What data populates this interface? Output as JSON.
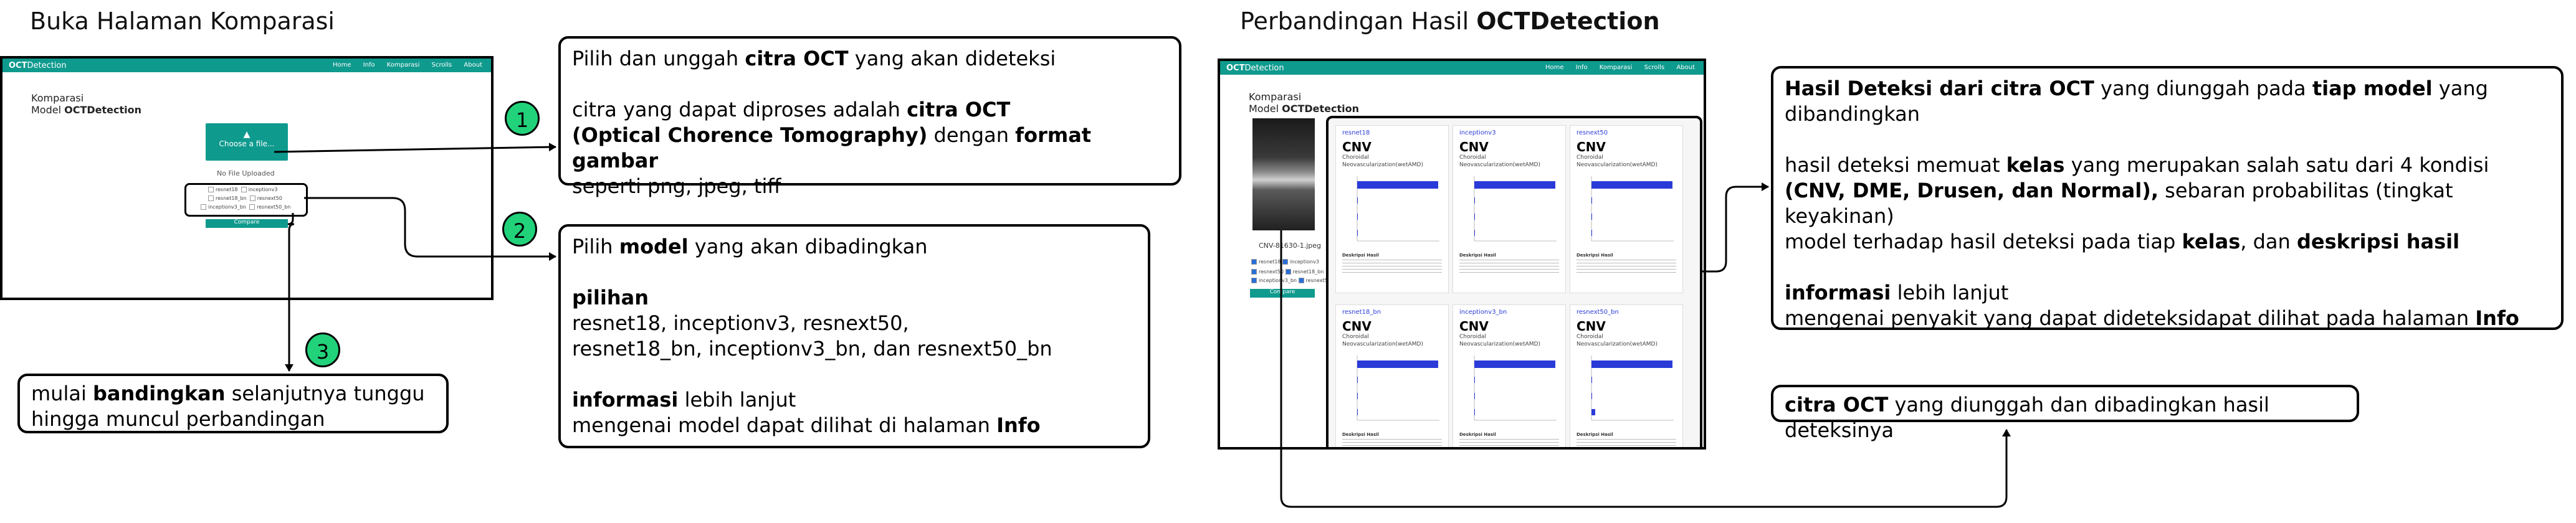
{
  "left_section": {
    "title": "Buka Halaman Komparasi",
    "screen": {
      "brand_bold": "OCT",
      "brand_rest": "Detection",
      "nav": [
        "Home",
        "Info",
        "Komparasi",
        "Scrolls",
        "About"
      ],
      "heading_line1": "Komparasi",
      "heading_model_prefix": "Model ",
      "heading_model": "OCTDetection",
      "choose_label": "Choose a file...",
      "no_file": "No File Uploaded",
      "checks": [
        "resnet18",
        "inceptionv3",
        "resnext50",
        "resnet18_bn",
        "inceptionv3_bn",
        "resnext50_bn"
      ],
      "compare_button": "Compare"
    }
  },
  "callouts": {
    "c1": {
      "l1_pre": "Pilih dan unggah ",
      "l1_b": "citra OCT",
      "l1_post": " yang akan dideteksi",
      "l2_pre": "citra yang dapat diproses adalah ",
      "l2_b": "citra OCT",
      "l3_b": "(Optical Chorence Tomography)",
      "l3_mid": " dengan ",
      "l3_b2": "format gambar",
      "l4": "seperti png, jpeg, tiff"
    },
    "c2": {
      "l1_pre": "Pilih ",
      "l1_b": "model",
      "l1_post": " yang akan dibadingkan",
      "l2_b": "pilihan",
      "l3": "resnet18, inceptionv3, resnext50,",
      "l4": "resnet18_bn, inceptionv3_bn, dan resnext50_bn",
      "l5_b": "informasi",
      "l5_post": " lebih lanjut",
      "l6_pre": "mengenai model dapat dilihat di halaman ",
      "l6_b": "Info"
    },
    "c3": {
      "l1_pre": "mulai ",
      "l1_b": "bandingkan",
      "l1_post": " selanjutnya tunggu",
      "l2": "hingga muncul perbandingan"
    },
    "c4": {
      "l1_b": "Hasil Deteksi dari citra OCT",
      "l1_mid": " yang diunggah pada ",
      "l1_b2": "tiap model",
      "l1_post": " yang",
      "l2": "dibandingkan",
      "l3_pre": "hasil deteksi memuat ",
      "l3_b": "kelas",
      "l3_post": " yang merupakan salah satu dari 4 kondisi",
      "l4_b": "(CNV, DME, Drusen, dan Normal),",
      "l4_post": " sebaran probabilitas (tingkat keyakinan)",
      "l5_pre": "model terhadap hasil deteksi pada tiap ",
      "l5_b": "kelas",
      "l5_mid": ", dan ",
      "l5_b2": "deskripsi hasil",
      "l6_b": "informasi",
      "l6_post": " lebih lanjut",
      "l7_pre": "mengenai penyakit yang dapat dideteksidapat dilihat pada halaman ",
      "l7_b": "Info"
    },
    "c5": {
      "l1_b": "citra OCT",
      "l1_post": " yang diunggah dan dibadingkan hasil deteksinya"
    }
  },
  "badges": [
    "1",
    "2",
    "3"
  ],
  "right_section": {
    "title_pre": "Perbandingan Hasil ",
    "title_b": "OCTDetection",
    "screen": {
      "brand_bold": "OCT",
      "brand_rest": "Detection",
      "nav": [
        "Home",
        "Info",
        "Komparasi",
        "Scrolls",
        "About"
      ],
      "heading_line1": "Komparasi",
      "heading_model_prefix": "Model ",
      "heading_model": "OCTDetection",
      "filename": "CNV-81630-1.jpeg",
      "checks": [
        "resnet18",
        "inceptionv3",
        "resnext50",
        "resnet18_bn",
        "inceptionv3_bn",
        "resnext50_bn"
      ],
      "compare_button": "Compare",
      "cards": [
        {
          "model": "resnet18",
          "cls": "CNV",
          "sub1": "Choroidal",
          "sub2": "Neovascularization(wetAMD)",
          "desc_title": "Deskripsi Hasil"
        },
        {
          "model": "inceptionv3",
          "cls": "CNV",
          "sub1": "Choroidal",
          "sub2": "Neovascularization(wetAMD)",
          "desc_title": "Deskripsi Hasil"
        },
        {
          "model": "resnext50",
          "cls": "CNV",
          "sub1": "Choroidal",
          "sub2": "Neovascularization(wetAMD)",
          "desc_title": "Deskripsi Hasil"
        },
        {
          "model": "resnet18_bn",
          "cls": "CNV",
          "sub1": "Choroidal",
          "sub2": "Neovascularization(wetAMD)",
          "desc_title": "Deskripsi Hasil"
        },
        {
          "model": "inceptionv3_bn",
          "cls": "CNV",
          "sub1": "Choroidal",
          "sub2": "Neovascularization(wetAMD)",
          "desc_title": "Deskripsi Hasil"
        },
        {
          "model": "resnext50_bn",
          "cls": "CNV",
          "sub1": "Choroidal",
          "sub2": "Neovascularization(wetAMD)",
          "desc_title": "Deskripsi Hasil"
        }
      ]
    }
  },
  "colors": {
    "teal": "#0f9a8e",
    "badge_green": "#22d27a",
    "bar_blue": "#2a3bd8"
  }
}
